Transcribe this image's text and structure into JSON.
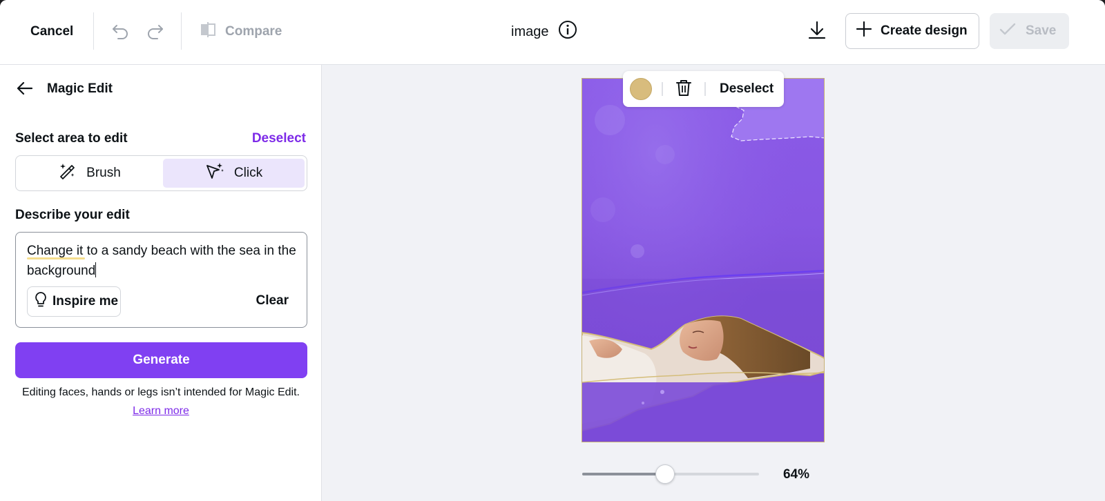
{
  "topbar": {
    "cancel_label": "Cancel",
    "compare_label": "Compare",
    "doc_title": "image",
    "create_design_label": "Create design",
    "save_label": "Save",
    "icons": [
      "undo-icon",
      "redo-icon",
      "compare-icon",
      "info-icon",
      "download-icon",
      "plus-icon",
      "check-icon"
    ]
  },
  "panel": {
    "title": "Magic Edit",
    "select_area_label": "Select area to edit",
    "deselect_label": "Deselect",
    "modes": [
      {
        "label": "Brush",
        "icon": "magic-brush-icon",
        "active": false
      },
      {
        "label": "Click",
        "icon": "magic-cursor-icon",
        "active": true
      }
    ],
    "describe_label": "Describe your edit",
    "prompt_value": "Change it to a sandy beach with the sea in the background",
    "inspire_label": "Inspire me",
    "clear_label": "Clear",
    "generate_label": "Generate",
    "disclaimer": "Editing faces, hands or legs isn’t intended for Magic Edit.",
    "learn_more": "Learn more"
  },
  "canvas": {
    "toolbar": {
      "swatch_color": "#d8bc7d",
      "deselect_label": "Deselect"
    },
    "zoom_label": "64%",
    "zoom_fraction": 0.47
  },
  "colors": {
    "accent": "#7d2ae8",
    "generate_bg": "#8040f2",
    "selection_overlay": "#8b5be8"
  }
}
